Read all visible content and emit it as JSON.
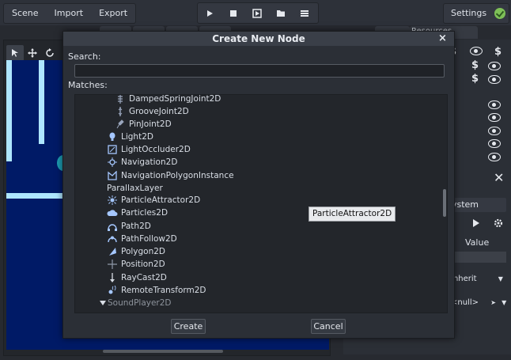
{
  "menu": [
    "Scene",
    "Import",
    "Export"
  ],
  "settings_label": "Settings",
  "background_tabs": {
    "resources": "Resources"
  },
  "right_panel": {
    "system_tab": "System",
    "value_header": "Value",
    "inherit_text": "Inherit",
    "null_text": "<null>"
  },
  "dialog": {
    "title": "Create New Node",
    "close": "×",
    "search_label": "Search:",
    "search_value": "",
    "matches_label": "Matches:",
    "create_button": "Create",
    "cancel_button": "Cancel",
    "tooltip": "ParticleAttractor2D",
    "items": [
      {
        "label": "DampedSpringJoint2D",
        "icon": "joint-icon"
      },
      {
        "label": "GrooveJoint2D",
        "icon": "groove-joint-icon"
      },
      {
        "label": "PinJoint2D",
        "icon": "pin-joint-icon"
      },
      {
        "label": "Light2D",
        "icon": "light-icon"
      },
      {
        "label": "LightOccluder2D",
        "icon": "light-occluder-icon"
      },
      {
        "label": "Navigation2D",
        "icon": "navigation-icon"
      },
      {
        "label": "NavigationPolygonInstance",
        "icon": "navigation-polygon-icon"
      },
      {
        "label": "ParallaxLayer",
        "icon": ""
      },
      {
        "label": "ParticleAttractor2D",
        "icon": "particle-attractor-icon"
      },
      {
        "label": "Particles2D",
        "icon": "particles-icon"
      },
      {
        "label": "Path2D",
        "icon": "path-icon"
      },
      {
        "label": "PathFollow2D",
        "icon": "path-follow-icon"
      },
      {
        "label": "Polygon2D",
        "icon": "polygon-icon"
      },
      {
        "label": "Position2D",
        "icon": "position-icon"
      },
      {
        "label": "RayCast2D",
        "icon": "raycast-icon"
      },
      {
        "label": "RemoteTransform2D",
        "icon": "remote-transform-icon"
      },
      {
        "label": "SoundPlayer2D",
        "icon": "expand-arrow-icon"
      }
    ]
  },
  "colors": {
    "canvas_bg": "#001a66",
    "canvas_bar": "#aee6ff",
    "accent_green": "#7ec057"
  }
}
